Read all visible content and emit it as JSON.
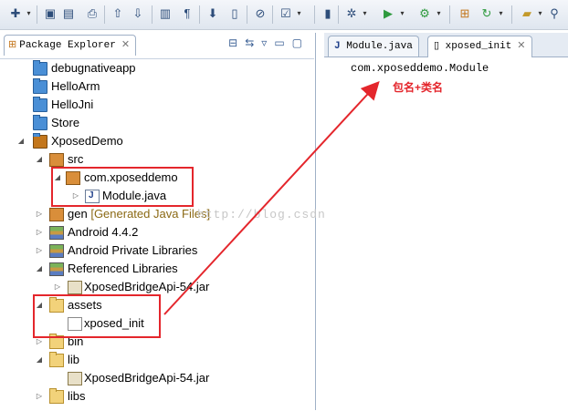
{
  "toolbar": {
    "icons": [
      "new-icon",
      "save-icon",
      "save-all-icon",
      "print-icon",
      "publish-icon",
      "download-icon",
      "console-icon",
      "paragraph-icon",
      "sdk-manager-icon",
      "avd-manager-icon",
      "skip-icon",
      "task-icon",
      "debug-icon",
      "run-icon",
      "external-tools-icon",
      "new-package-icon",
      "refresh-icon",
      "open-folder-icon",
      "search-icon"
    ]
  },
  "explorer": {
    "tab_label": "Package Explorer",
    "items": [
      {
        "label": "debugnativeapp"
      },
      {
        "label": "HelloArm"
      },
      {
        "label": "HelloJni"
      },
      {
        "label": "Store"
      },
      {
        "label": "XposedDemo"
      },
      {
        "label": "src"
      },
      {
        "label": "com.xposeddemo"
      },
      {
        "label": "Module.java"
      },
      {
        "label": "gen",
        "decoration": "[Generated Java Files]"
      },
      {
        "label": "Android 4.4.2"
      },
      {
        "label": "Android Private Libraries"
      },
      {
        "label": "Referenced Libraries"
      },
      {
        "label": "XposedBridgeApi-54.jar"
      },
      {
        "label": "assets"
      },
      {
        "label": "xposed_init"
      },
      {
        "label": "bin"
      },
      {
        "label": "lib"
      },
      {
        "label": "XposedBridgeApi-54.jar"
      },
      {
        "label": "libs"
      }
    ]
  },
  "editor": {
    "tabs": [
      {
        "label": "Module.java"
      },
      {
        "label": "xposed_init"
      }
    ],
    "content": "com.xposeddemo.Module"
  },
  "annotation": {
    "note": "包名+类名",
    "color": "#e4262c"
  },
  "watermark": "http://blog.csdn.net/"
}
